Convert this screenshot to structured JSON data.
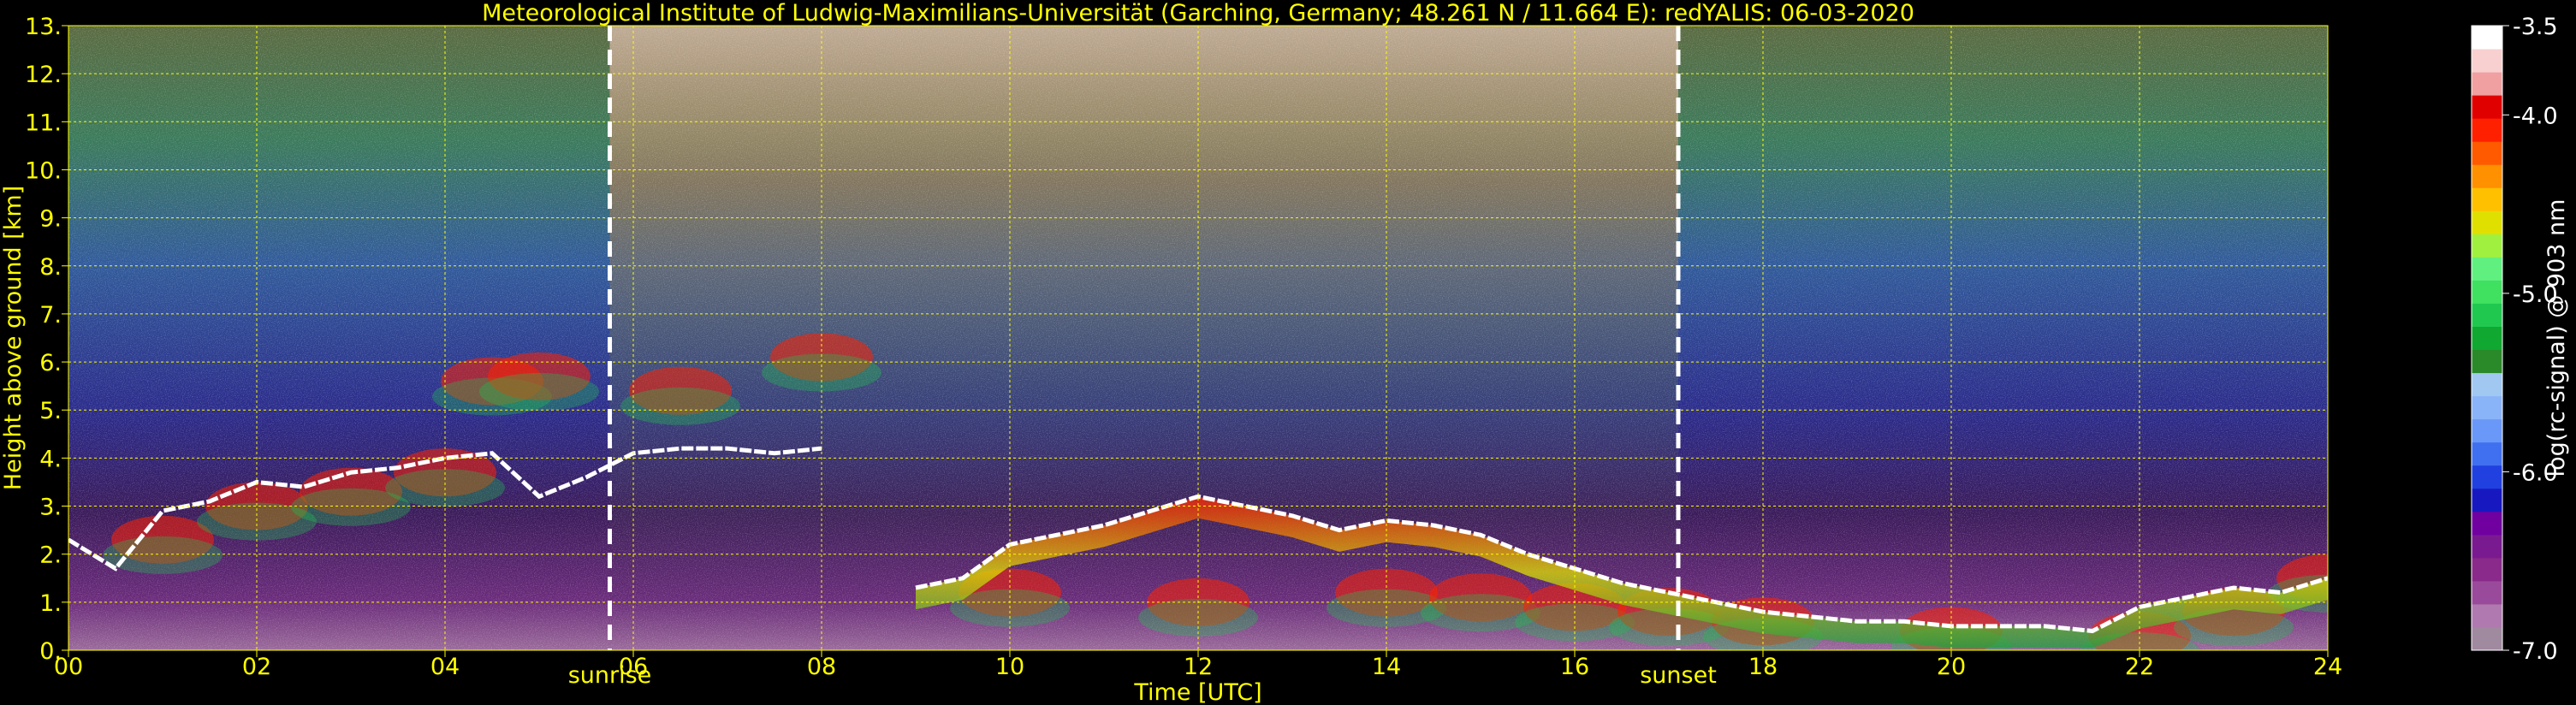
{
  "title": "Meteorological Institute of Ludwig-Maximilians-Universität (Garching, Germany; 48.261 N / 11.664 E):    redYALIS: 06-03-2020",
  "colorbar_label": "log(rc-signal) @ 903 nm",
  "chart_data": {
    "type": "heatmap",
    "xlabel": "Time [UTC]",
    "ylabel": "Height above ground [km]",
    "xlim": [
      0,
      24
    ],
    "ylim": [
      0,
      13
    ],
    "grid": true,
    "grid_color": "#ffff00",
    "label_color": "#ffff00",
    "x_ticks": [
      0,
      2,
      4,
      6,
      8,
      10,
      12,
      14,
      16,
      18,
      20,
      22,
      24
    ],
    "x_tick_labels": [
      "00",
      "02",
      "04",
      "06",
      "08",
      "10",
      "12",
      "14",
      "16",
      "18",
      "20",
      "22",
      "24"
    ],
    "y_ticks": [
      0,
      1,
      2,
      3,
      4,
      5,
      6,
      7,
      8,
      9,
      10,
      11,
      12,
      13
    ],
    "y_tick_labels": [
      "0.",
      "1.",
      "2.",
      "3.",
      "4.",
      "5.",
      "6.",
      "7.",
      "8.",
      "9.",
      "10.",
      "11.",
      "12.",
      "13."
    ],
    "markers": [
      {
        "label": "sunrise",
        "x": 5.75
      },
      {
        "label": "sunset",
        "x": 17.1
      }
    ],
    "colorbar": {
      "range": [
        -7.0,
        -3.5
      ],
      "ticks": [
        -7.0,
        -6.0,
        -5.0,
        -4.0,
        -3.5
      ],
      "tick_labels": [
        "-7.0",
        "-6.0",
        "-5.0",
        "-4.0",
        "-3.5"
      ],
      "colors": [
        "#a08aa0",
        "#b07ab0",
        "#9a4a9a",
        "#8a2a8a",
        "#7a1a90",
        "#7000a0",
        "#1818c0",
        "#2040e0",
        "#4070f0",
        "#6a98f8",
        "#8ab4f8",
        "#a0c8f0",
        "#2a8a2a",
        "#10a830",
        "#20c850",
        "#40e060",
        "#60f080",
        "#a0f040",
        "#e0e000",
        "#ffc000",
        "#ff9000",
        "#ff5a00",
        "#ff2000",
        "#e00000",
        "#f0a0a0",
        "#f8d0d0",
        "#ffffff"
      ]
    },
    "series": [
      {
        "name": "",
        "kind": "cloud_top_line",
        "x": [
          0.0,
          0.5,
          1.0,
          1.5,
          2.0,
          2.5,
          3.0,
          3.5,
          4.0,
          4.5,
          5.0,
          5.5,
          6.0,
          6.5,
          7.0,
          7.5,
          8.0
        ],
        "y": [
          2.3,
          1.7,
          2.9,
          3.1,
          3.5,
          3.4,
          3.7,
          3.8,
          4.0,
          4.1,
          3.2,
          3.6,
          4.1,
          4.2,
          4.2,
          4.1,
          4.2
        ]
      },
      {
        "name": "",
        "kind": "cloud_top_line",
        "x": [
          9.0,
          9.5,
          10.0,
          10.5,
          11.0,
          11.5,
          12.0,
          12.5,
          13.0,
          13.5,
          14.0,
          14.5,
          15.0,
          15.5,
          16.0,
          16.5,
          17.0,
          17.5,
          18.0,
          18.5,
          19.0,
          19.5,
          20.0,
          20.5,
          21.0,
          21.5,
          22.0,
          22.5,
          23.0,
          23.5,
          24.0
        ],
        "y": [
          1.3,
          1.5,
          2.2,
          2.4,
          2.6,
          2.9,
          3.2,
          3.0,
          2.8,
          2.5,
          2.7,
          2.6,
          2.4,
          2.0,
          1.7,
          1.4,
          1.2,
          1.0,
          0.8,
          0.7,
          0.6,
          0.6,
          0.5,
          0.5,
          0.5,
          0.4,
          0.9,
          1.1,
          1.3,
          1.2,
          1.5
        ]
      },
      {
        "name": "",
        "kind": "aerosol_layer",
        "x": [
          1.0,
          2.0,
          3.0,
          4.0,
          4.5,
          5.0,
          6.5,
          8.0,
          10.0,
          12.0,
          14.0,
          15.0,
          16.0,
          17.0,
          18.0,
          20.0,
          22.0,
          23.0,
          24.0
        ],
        "y": [
          2.3,
          3.0,
          3.3,
          3.7,
          5.6,
          5.7,
          5.4,
          6.1,
          1.2,
          1.0,
          1.2,
          1.1,
          0.9,
          0.8,
          0.6,
          0.4,
          0.3,
          0.8,
          1.5
        ]
      }
    ]
  }
}
